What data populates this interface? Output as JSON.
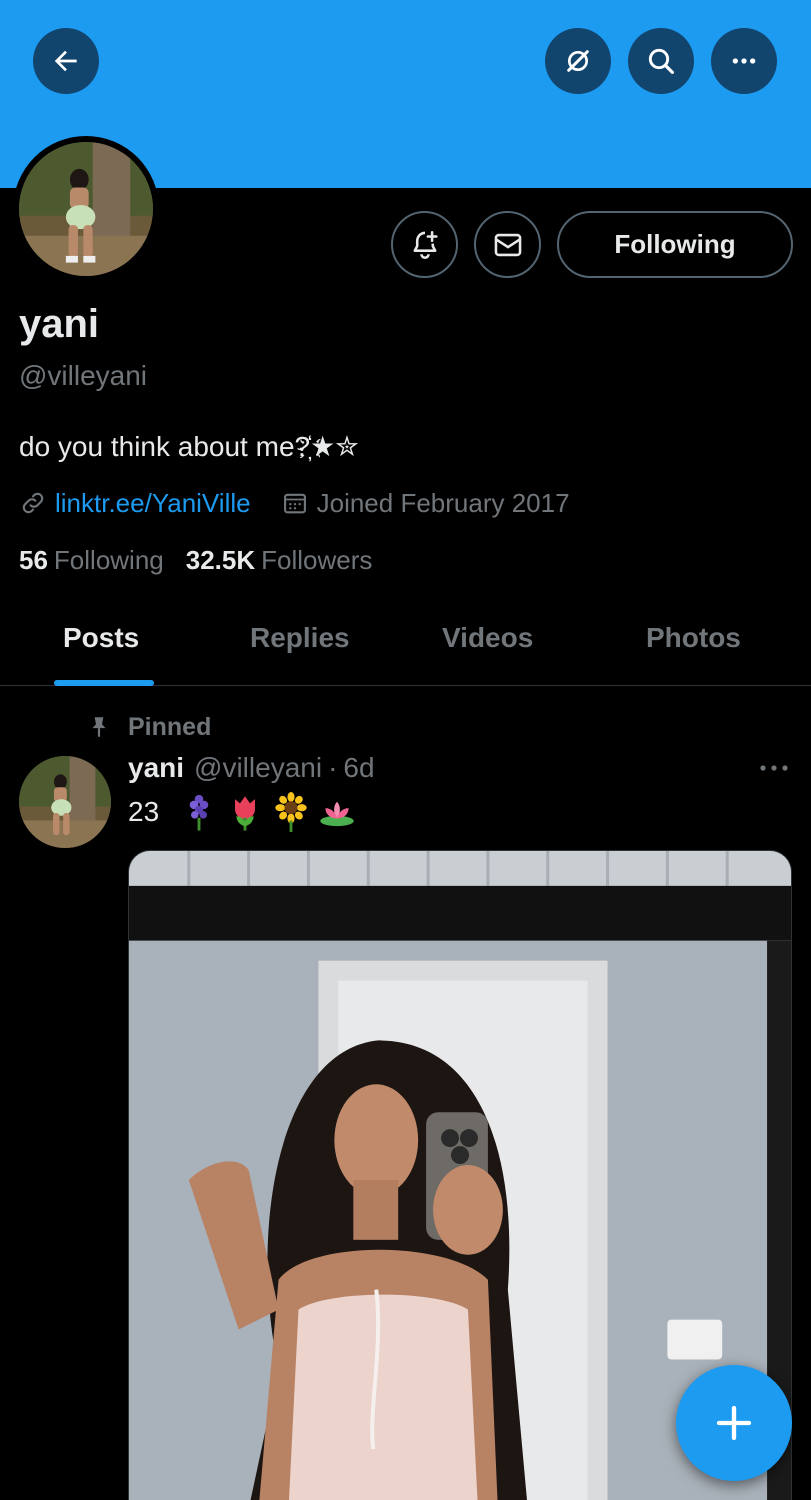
{
  "header": {
    "back_icon": "arrow-left-icon",
    "grok_icon": "grok-icon",
    "search_icon": "search-icon",
    "more_icon": "more-horizontal-icon",
    "banner_color": "#1d9bf0"
  },
  "profile": {
    "display_name": "yani",
    "handle": "@villeyani",
    "bio": "do you think about me?",
    "bio_symbols": "҉★✮",
    "link": "linktr.ee/YaniVille",
    "joined": "Joined February 2017",
    "following_count": "56",
    "following_label": "Following",
    "followers_count": "32.5K",
    "followers_label": "Followers"
  },
  "actions": {
    "notify_icon": "bell-plus-icon",
    "message_icon": "envelope-icon",
    "follow_button_label": "Following"
  },
  "tabs": [
    {
      "label": "Posts",
      "active": true
    },
    {
      "label": "Replies",
      "active": false
    },
    {
      "label": "Videos",
      "active": false
    },
    {
      "label": "Photos",
      "active": false
    }
  ],
  "post": {
    "pinned_label": "Pinned",
    "author_name": "yani",
    "author_handle": "@villeyani",
    "separator": "·",
    "time": "6d",
    "text": "23",
    "emojis": [
      "hyacinth",
      "tulip",
      "sunflower",
      "lotus"
    ],
    "more_icon": "more-horizontal-icon"
  },
  "fab": {
    "icon": "plus-icon"
  },
  "colors": {
    "accent": "#1d9bf0",
    "muted": "#71767b",
    "text": "#e7e9ea",
    "background": "#000000"
  }
}
